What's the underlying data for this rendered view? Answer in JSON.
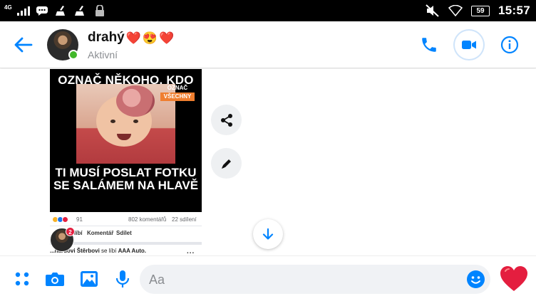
{
  "colors": {
    "accent": "#0084ff",
    "online": "#42b72a",
    "status_bar": "#000000",
    "heart": "#e41e3f"
  },
  "status_bar": {
    "network": "4G",
    "battery": "59",
    "time": "15:57",
    "icons": [
      "signal-icon",
      "message-notification-icon",
      "cleaner-icon",
      "cleaner-icon",
      "lock-icon",
      "mute-icon",
      "wifi-icon"
    ]
  },
  "header": {
    "contact_name": "drahý",
    "name_emojis": [
      "❤️",
      "😍",
      "❤️"
    ],
    "status": "Aktivní"
  },
  "post": {
    "headline_top": "OZNAČ NĚKOHO, KDO",
    "tag_small": "OZNAČ",
    "tag_orange": "VŠECHNY",
    "headline_bottom": "TI MUSÍ POSLAT FOTKU SE SALÁMEM NA HLAVĚ",
    "reactions_count": "91",
    "comments": "802 komentářů",
    "shares": "22 sdílení",
    "action_like": "líbí",
    "action_comment": "Komentář",
    "action_share": "Sdílet",
    "activity_name": "...hardovi Štěrbovi",
    "activity_text": " se líbí ",
    "activity_page": "AAA Auto.",
    "more": "..."
  },
  "sender_badge": "2",
  "composer": {
    "placeholder": "Aa"
  }
}
